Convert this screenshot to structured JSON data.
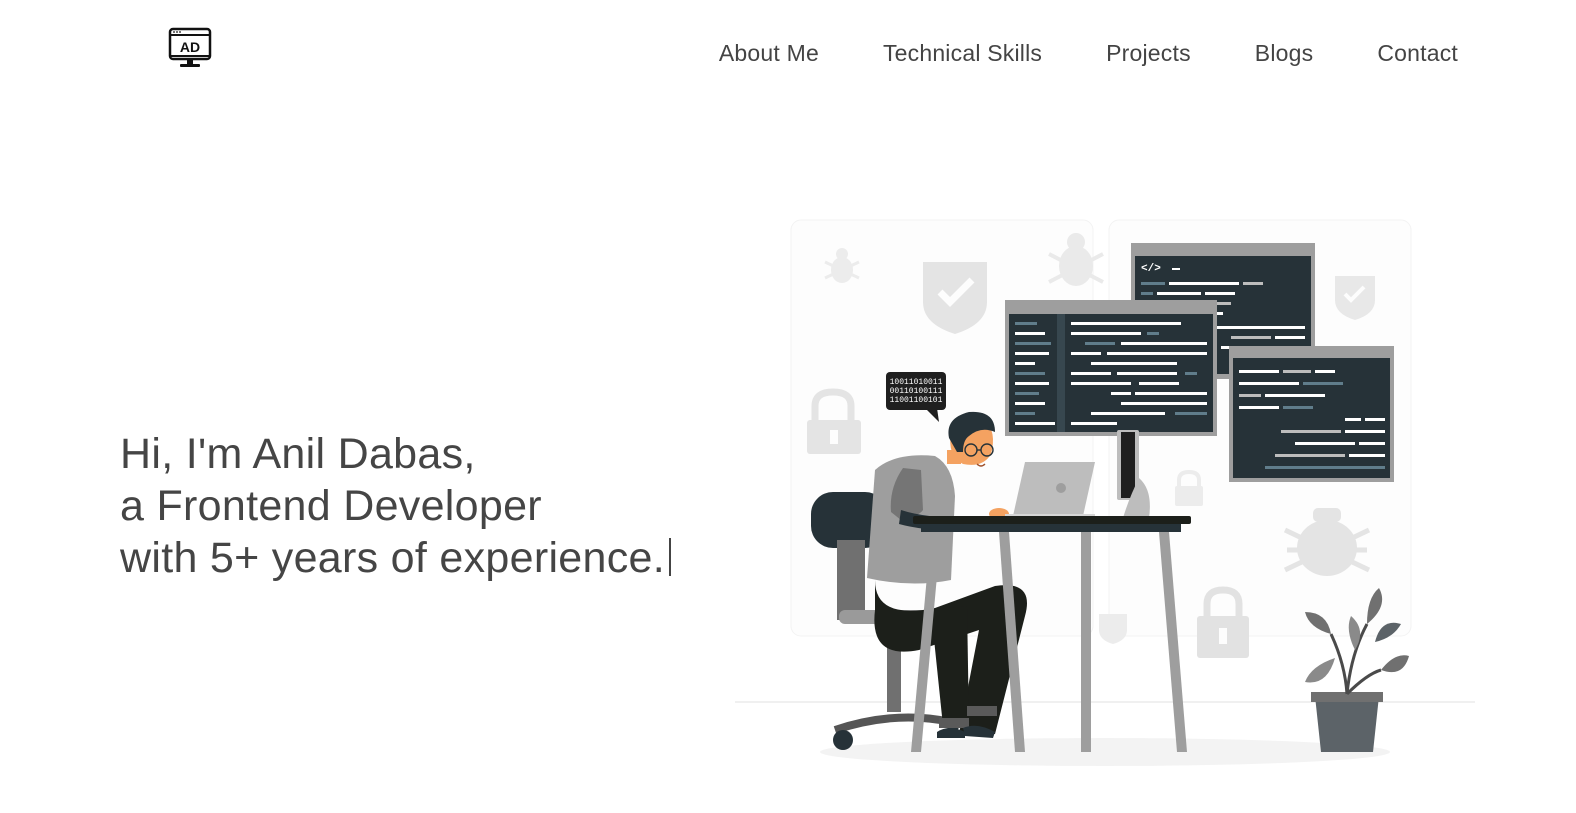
{
  "logo": {
    "text": "AD",
    "icon": "monitor-icon"
  },
  "nav": {
    "items": [
      "About Me",
      "Technical Skills",
      "Projects",
      "Blogs",
      "Contact"
    ]
  },
  "hero": {
    "line1": "Hi, I'm Anil Dabas,",
    "line2": "a Frontend Developer",
    "line3": "with 5+ years of experience."
  },
  "illustration": {
    "speech_bubble": [
      "10011010011",
      "00110100111",
      "11001100101"
    ],
    "code_tag": "</>"
  },
  "colors": {
    "text": "#454545",
    "dark_screen": "#263238",
    "frame_gray": "#9e9e9e",
    "light_gray": "#e6e6e6"
  }
}
